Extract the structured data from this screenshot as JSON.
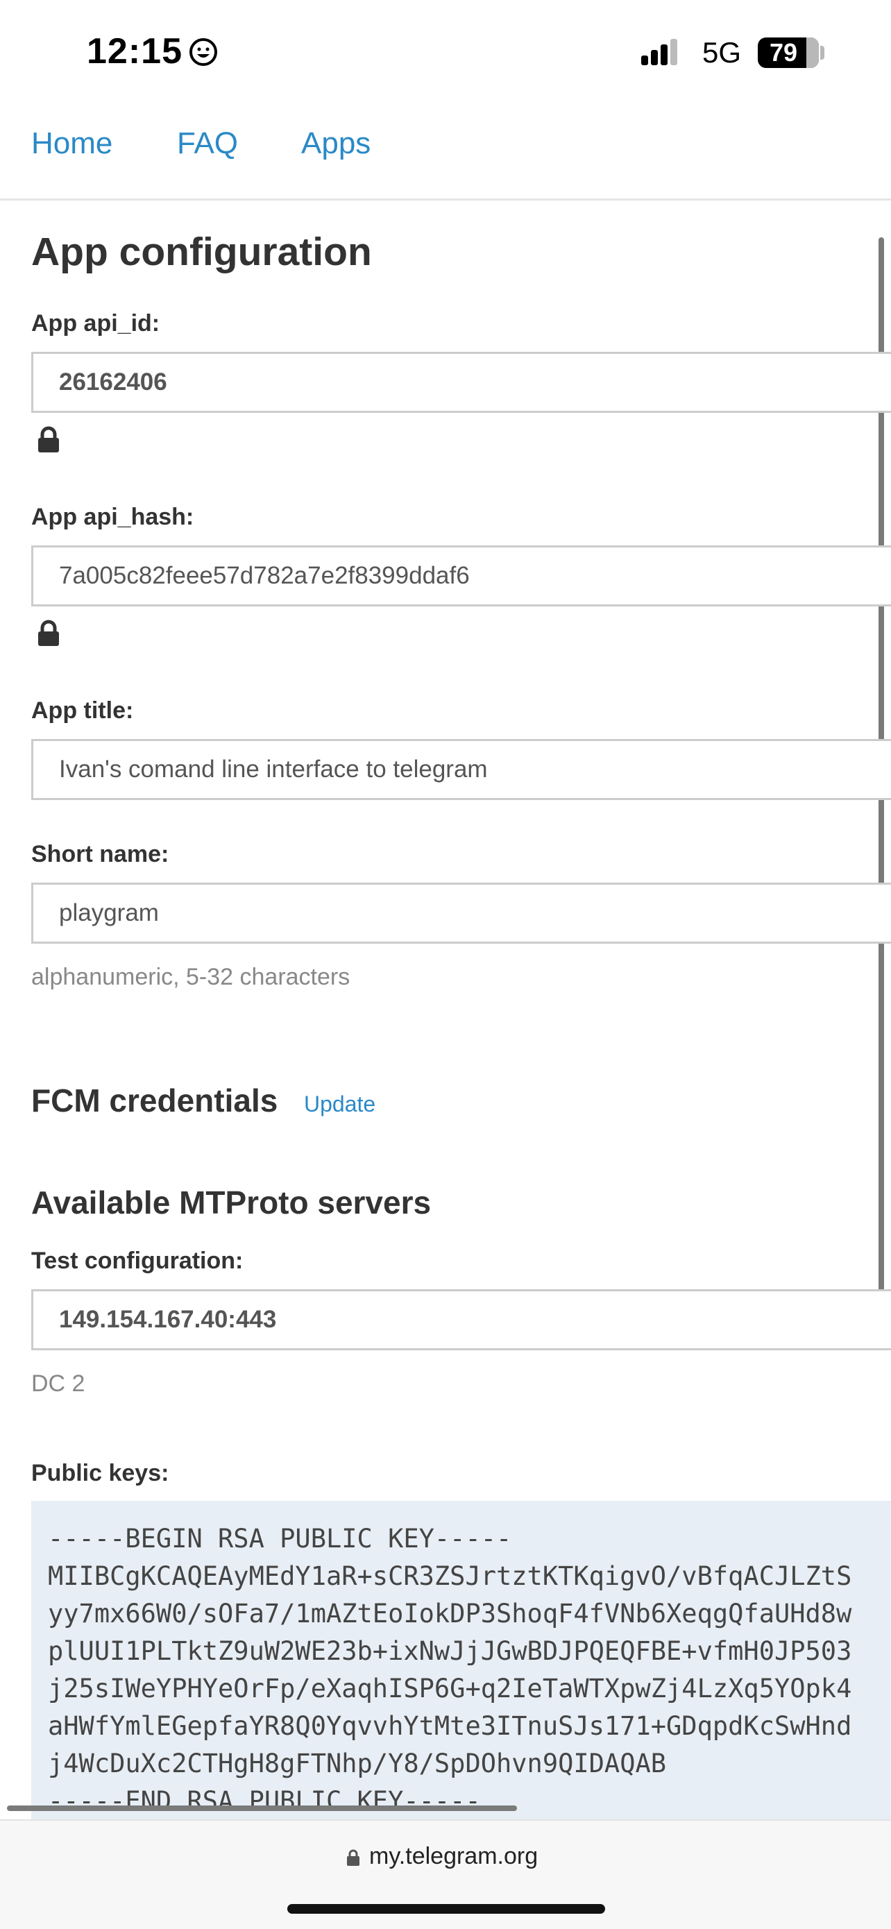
{
  "status_bar": {
    "time": "12:15",
    "network": "5G",
    "battery": "79",
    "battery_level": 0.79
  },
  "nav": {
    "home": "Home",
    "faq": "FAQ",
    "apps": "Apps"
  },
  "page_title": "App configuration",
  "api_id": {
    "label": "App api_id:",
    "value": "26162406"
  },
  "api_hash": {
    "label": "App api_hash:",
    "value": "7a005c82feee57d782a7e2f8399ddaf6"
  },
  "app_title": {
    "label": "App title:",
    "value": "Ivan's comand line interface to telegram"
  },
  "short_name": {
    "label": "Short name:",
    "value": "playgram",
    "hint": "alphanumeric, 5-32 characters"
  },
  "fcm": {
    "heading": "FCM credentials",
    "update": "Update"
  },
  "servers": {
    "heading": "Available MTProto servers",
    "test_label": "Test configuration:",
    "test_value": "149.154.167.40:443",
    "test_dc": "DC 2"
  },
  "public_keys": {
    "label": "Public keys:",
    "text": "-----BEGIN RSA PUBLIC KEY-----\nMIIBCgKCAQEAyMEdY1aR+sCR3ZSJrtztKTKqigvO/vBfqACJLZtS\nyy7mx66W0/sOFa7/1mAZtEoIokDP3ShoqF4fVNb6XeqgQfaUHd8w\nplUUI1PLTktZ9uW2WE23b+ixNwJjJGwBDJPQEQFBE+vfmH0JP503\nj25sIWeYPHYeOrFp/eXaqhISP6G+q2IeTaWTXpwZj4LzXq5YOpk4\naHWfYmlEGepfaYR8Q0YqvvhYtMte3ITnuSJs171+GDqpdKcSwHnd\nj4WcDuXc2CTHgH8gFTNhp/Y8/SpDOhvn9QIDAQAB\n-----END RSA PUBLIC KEY-----"
  },
  "browser": {
    "url": "my.telegram.org"
  }
}
